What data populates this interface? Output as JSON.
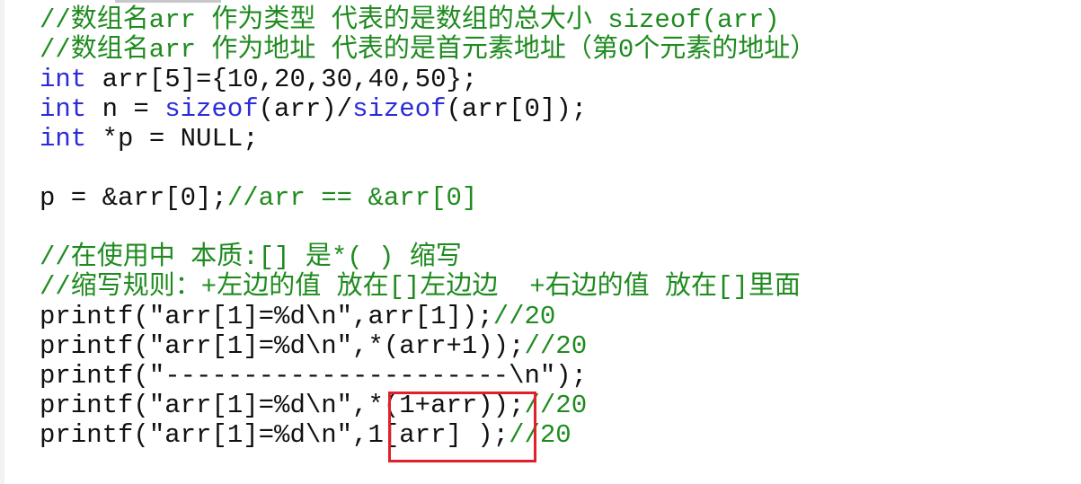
{
  "code": {
    "lines": [
      [
        {
          "t": "//数组名arr 作为类型 代表的是数组的总大小 sizeof(arr)",
          "c": "cm"
        }
      ],
      [
        {
          "t": "//数组名arr 作为地址 代表的是首元素地址（第0个元素的地址）",
          "c": "cm"
        }
      ],
      [
        {
          "t": "int",
          "c": "kw"
        },
        {
          "t": " arr[5]={10,20,30,40,50};",
          "c": "tx"
        }
      ],
      [
        {
          "t": "int",
          "c": "kw"
        },
        {
          "t": " n = ",
          "c": "tx"
        },
        {
          "t": "sizeof",
          "c": "kw"
        },
        {
          "t": "(arr)/",
          "c": "tx"
        },
        {
          "t": "sizeof",
          "c": "kw"
        },
        {
          "t": "(arr[0]);",
          "c": "tx"
        }
      ],
      [
        {
          "t": "int",
          "c": "kw"
        },
        {
          "t": " *p = NULL;",
          "c": "tx"
        }
      ],
      [],
      [
        {
          "t": "p = &arr[0];",
          "c": "tx"
        },
        {
          "t": "//arr == &arr[0]",
          "c": "cm"
        }
      ],
      [],
      [
        {
          "t": "//在使用中 本质:[] 是*( ) 缩写",
          "c": "cm"
        }
      ],
      [
        {
          "t": "//缩写规则：+左边的值 放在[]左边边  +右边的值 放在[]里面",
          "c": "cm"
        }
      ],
      [
        {
          "t": "printf(\"arr[1]=%d\\n\",arr[1]);",
          "c": "tx"
        },
        {
          "t": "//20",
          "c": "cm"
        }
      ],
      [
        {
          "t": "printf(\"arr[1]=%d\\n\",*(arr+1));",
          "c": "tx"
        },
        {
          "t": "//20",
          "c": "cm"
        }
      ],
      [
        {
          "t": "printf(\"----------------------\\n\");",
          "c": "tx"
        }
      ],
      [
        {
          "t": "printf(\"arr[1]=%d\\n\",*(1+arr));",
          "c": "tx"
        },
        {
          "t": "//20",
          "c": "cm"
        }
      ],
      [
        {
          "t": "printf(\"arr[1]=%d\\n\",1[arr] );",
          "c": "tx"
        },
        {
          "t": "//20",
          "c": "cm"
        }
      ]
    ]
  },
  "colors": {
    "comment": "#1f8b1f",
    "keyword": "#2b2bd8",
    "text": "#111111",
    "highlight_border": "#e0202a"
  }
}
